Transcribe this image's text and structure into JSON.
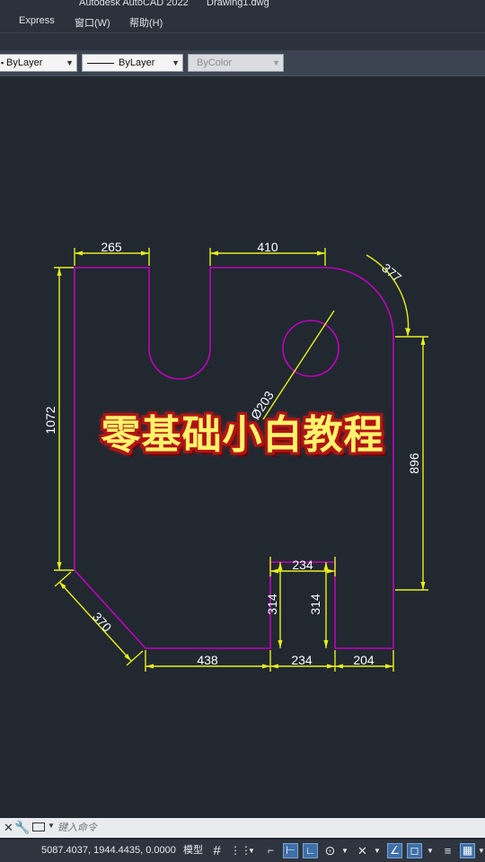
{
  "app": {
    "title": "Autodesk AutoCAD 2022",
    "document": "Drawing1.dwg"
  },
  "menu": {
    "items": [
      "Express",
      "窗口(W)",
      "帮助(H)"
    ]
  },
  "properties": {
    "color_value": "ByLayer",
    "linetype_value": "ByLayer",
    "lineweight_value": "ByColor"
  },
  "drawing": {
    "dimensions": {
      "top_left": "265",
      "top_right": "410",
      "arc": "377",
      "diameter": "Ø203",
      "left": "1072",
      "right": "896",
      "notch_top": "234",
      "notch_left_height": "314",
      "notch_right_height": "314",
      "bottom_1": "438",
      "bottom_2": "234",
      "bottom_3": "204",
      "chamfer": "370"
    },
    "colors": {
      "outline": "#c000c0",
      "dimension": "#e8ef1a",
      "text": "#ffffff"
    }
  },
  "overlay": {
    "text": "零基础小白教程",
    "color": "#fff36a"
  },
  "command": {
    "placeholder": "键入命令"
  },
  "status": {
    "coordinates": "5087.4037, 1944.4435, 0.0000",
    "model_label": "模型"
  },
  "icons": [
    "close-icon",
    "wrench-icon",
    "command-icon",
    "grid-icon",
    "snap-icon",
    "ortho-icon",
    "polar-icon",
    "osnap-icon",
    "lineweight-icon",
    "transparency-icon"
  ]
}
